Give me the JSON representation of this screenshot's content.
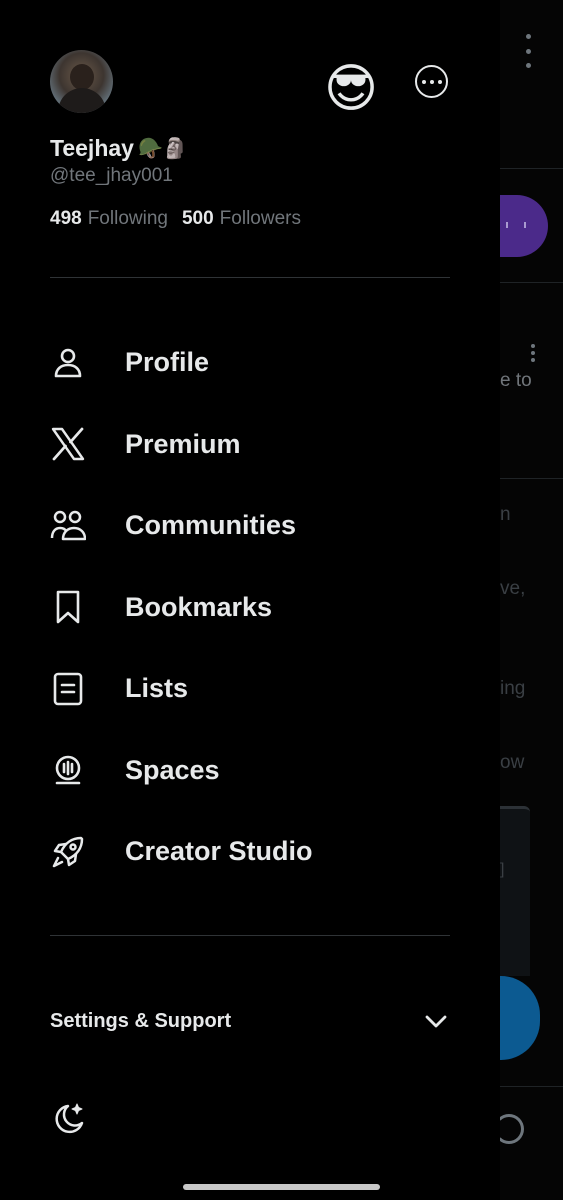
{
  "profile": {
    "display_name": "Teejhay",
    "name_emojis": "🪖🗿",
    "handle": "@tee_jhay001",
    "following_count": "498",
    "following_label": "Following",
    "followers_count": "500",
    "followers_label": "Followers"
  },
  "header": {
    "account_switch_emoji": "😎"
  },
  "menu": {
    "items": [
      {
        "label": "Profile",
        "icon": "person-icon"
      },
      {
        "label": "Premium",
        "icon": "x-logo-icon"
      },
      {
        "label": "Communities",
        "icon": "communities-icon"
      },
      {
        "label": "Bookmarks",
        "icon": "bookmark-icon"
      },
      {
        "label": "Lists",
        "icon": "list-icon"
      },
      {
        "label": "Spaces",
        "icon": "spaces-icon"
      },
      {
        "label": "Creator Studio",
        "icon": "rocket-icon"
      }
    ]
  },
  "settings": {
    "label": "Settings & Support"
  },
  "background_feed": {
    "snippets": [
      "e to",
      "n",
      "ve,",
      "ing",
      "ow",
      "]"
    ]
  },
  "colors": {
    "background": "#000000",
    "primary_text": "#e7e9ea",
    "secondary_text": "#71767b",
    "divider": "#2f3336",
    "accent_purple": "#4b2a8a",
    "accent_blue": "#0c5a91"
  }
}
